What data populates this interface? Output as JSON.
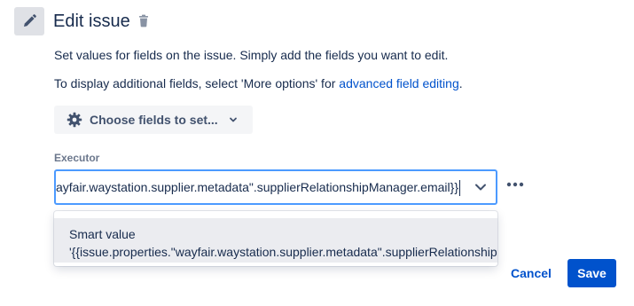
{
  "header": {
    "title": "Edit issue",
    "icon": "pencil-icon",
    "delete_icon": "trash-icon"
  },
  "description": {
    "line1": "Set values for fields on the issue. Simply add the fields you want to edit.",
    "line2_prefix": "To display additional fields, select 'More options' for ",
    "line2_link": "advanced field editing",
    "line2_suffix": "."
  },
  "choose_fields": {
    "label": "Choose fields to set...",
    "icon": "gear-icon"
  },
  "executor": {
    "label": "Executor",
    "value": "{{issue.properties.\"wayfair.waystation.supplier.metadata\".supplierRelationshipManager.email}}"
  },
  "suggestion": {
    "title": "Smart value",
    "value": "'{{issue.properties.\"wayfair.waystation.supplier.metadata\".supplierRelationshipManager.email}}'"
  },
  "footer": {
    "cancel_label": "Cancel",
    "save_label": "Save"
  },
  "colors": {
    "primary": "#0052cc",
    "focus_border": "#4c9aff",
    "text": "#172b4d",
    "subtle_bg": "#f4f5f7"
  }
}
